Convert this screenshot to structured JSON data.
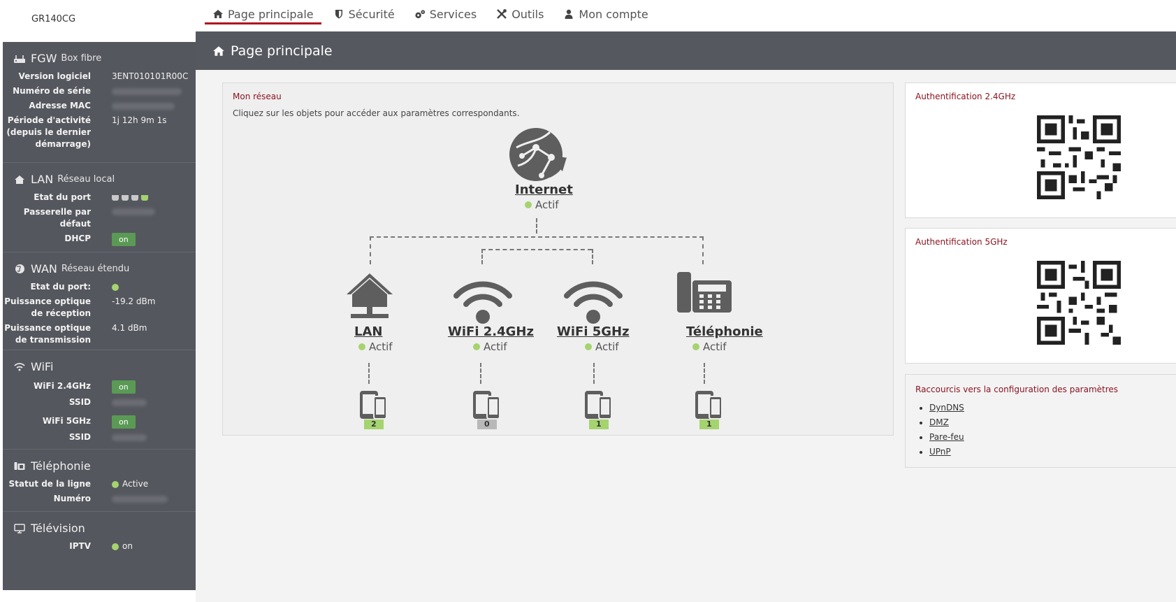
{
  "brand": "GR140CG",
  "nav": [
    {
      "label": "Page principale",
      "icon": "home-icon",
      "active": true
    },
    {
      "label": "Sécurité",
      "icon": "shield-icon",
      "active": false
    },
    {
      "label": "Services",
      "icon": "gears-icon",
      "active": false
    },
    {
      "label": "Outils",
      "icon": "tools-icon",
      "active": false
    },
    {
      "label": "Mon compte",
      "icon": "user-icon",
      "active": false
    }
  ],
  "sidebar": {
    "fgw": {
      "title": "FGW",
      "subtitle": "Box fibre",
      "rows": [
        {
          "label": "Version logiciel",
          "value": "3ENT010101R00C"
        },
        {
          "label": "Numéro de série",
          "value": ""
        },
        {
          "label": "Adresse MAC",
          "value": ""
        },
        {
          "label": "Période d'activité (depuis le dernier démarrage)",
          "value": "1j 12h 9m 1s"
        }
      ]
    },
    "lan": {
      "title": "LAN",
      "subtitle": "Réseau local",
      "port_label": "Etat du port",
      "ports": [
        false,
        false,
        false,
        true
      ],
      "gateway_label": "Passerelle par défaut",
      "dhcp_label": "DHCP",
      "dhcp_value": "on"
    },
    "wan": {
      "title": "WAN",
      "subtitle": "Réseau étendu",
      "port_label": "Etat du port:",
      "rx_label": "Puissance optique de réception",
      "rx_value": "-19.2 dBm",
      "tx_label": "Puissance optique de transmission",
      "tx_value": "4.1 dBm"
    },
    "wifi": {
      "title": "WiFi",
      "w24_label": "WiFi 2.4GHz",
      "w24_value": "on",
      "ssid_label": "SSID",
      "w5_label": "WiFi 5GHz",
      "w5_value": "on",
      "ssid5_label": "SSID"
    },
    "tel": {
      "title": "Téléphonie",
      "line_label": "Statut de la ligne",
      "line_value": "Active",
      "num_label": "Numéro"
    },
    "tv": {
      "title": "Télévision",
      "iptv_label": "IPTV",
      "iptv_value": "on"
    }
  },
  "main": {
    "title": "Page principale",
    "network": {
      "title": "Mon réseau",
      "hint": "Cliquez sur les objets pour accéder aux paramètres correspondants.",
      "internet": {
        "label": "Internet",
        "status": "Actif"
      },
      "nodes": [
        {
          "label": "LAN",
          "status": "Actif",
          "count": "2"
        },
        {
          "label": "WiFi 2.4GHz",
          "status": "Actif",
          "count": "0"
        },
        {
          "label": "WiFi 5GHz",
          "status": "Actif",
          "count": "1"
        },
        {
          "label": "Téléphonie",
          "status": "Actif",
          "count": "1"
        }
      ]
    },
    "qr24_title": "Authentification 2.4GHz",
    "qr5_title": "Authentification 5GHz",
    "shortcuts": {
      "title": "Raccourcis vers la configuration des paramètres",
      "links": [
        "DynDNS",
        "DMZ",
        "Pare-feu",
        "UPnP"
      ]
    }
  },
  "colors": {
    "accent": "#b0121f",
    "panel": "#55575e",
    "active_dot": "#a5d36f",
    "pill": "#5a9a55"
  }
}
